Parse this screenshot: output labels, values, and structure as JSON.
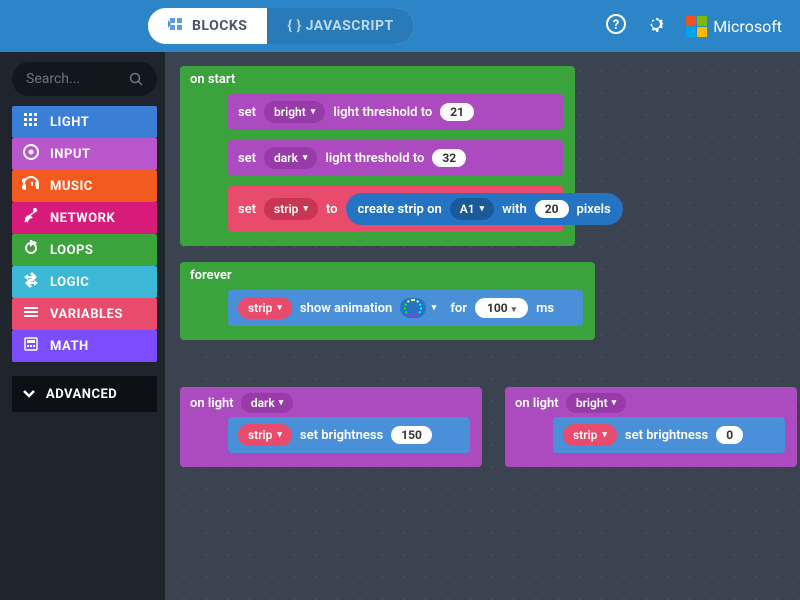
{
  "topbar": {
    "tab_blocks": "BLOCKS",
    "tab_js": "{ } JAVASCRIPT",
    "brand": "Microsoft"
  },
  "sidebar": {
    "search_placeholder": "Search...",
    "categories": [
      {
        "label": "LIGHT",
        "color": "#3b7ed6"
      },
      {
        "label": "INPUT",
        "color": "#b956cc"
      },
      {
        "label": "MUSIC",
        "color": "#f25a1f"
      },
      {
        "label": "NETWORK",
        "color": "#d81b7a"
      },
      {
        "label": "LOOPS",
        "color": "#3ba33b"
      },
      {
        "label": "LOGIC",
        "color": "#3cb7d6"
      },
      {
        "label": "VARIABLES",
        "color": "#e94b6c"
      },
      {
        "label": "MATH",
        "color": "#7c4dff"
      }
    ],
    "advanced": "ADVANCED"
  },
  "blocks": {
    "onstart": {
      "title": "on start",
      "rows": [
        {
          "pre": "set",
          "pill": "bright",
          "mid": "light threshold to",
          "val": "21"
        },
        {
          "pre": "set",
          "pill": "dark",
          "mid": "light threshold to",
          "val": "32"
        },
        {
          "pre": "set",
          "pill": "strip",
          "mid": "to",
          "create": {
            "t1": "create strip on",
            "pin": "A1",
            "t2": "with",
            "n": "20",
            "t3": "pixels"
          }
        }
      ]
    },
    "forever": {
      "title": "forever",
      "row": {
        "pill": "strip",
        "t1": "show animation",
        "t2": "for",
        "val": "100",
        "unit": "ms"
      }
    },
    "onlight1": {
      "title": "on light",
      "cond": "dark",
      "row": {
        "pill": "strip",
        "t1": "set brightness",
        "val": "150"
      }
    },
    "onlight2": {
      "title": "on light",
      "cond": "bright",
      "row": {
        "pill": "strip",
        "t1": "set brightness",
        "val": "0"
      }
    }
  }
}
